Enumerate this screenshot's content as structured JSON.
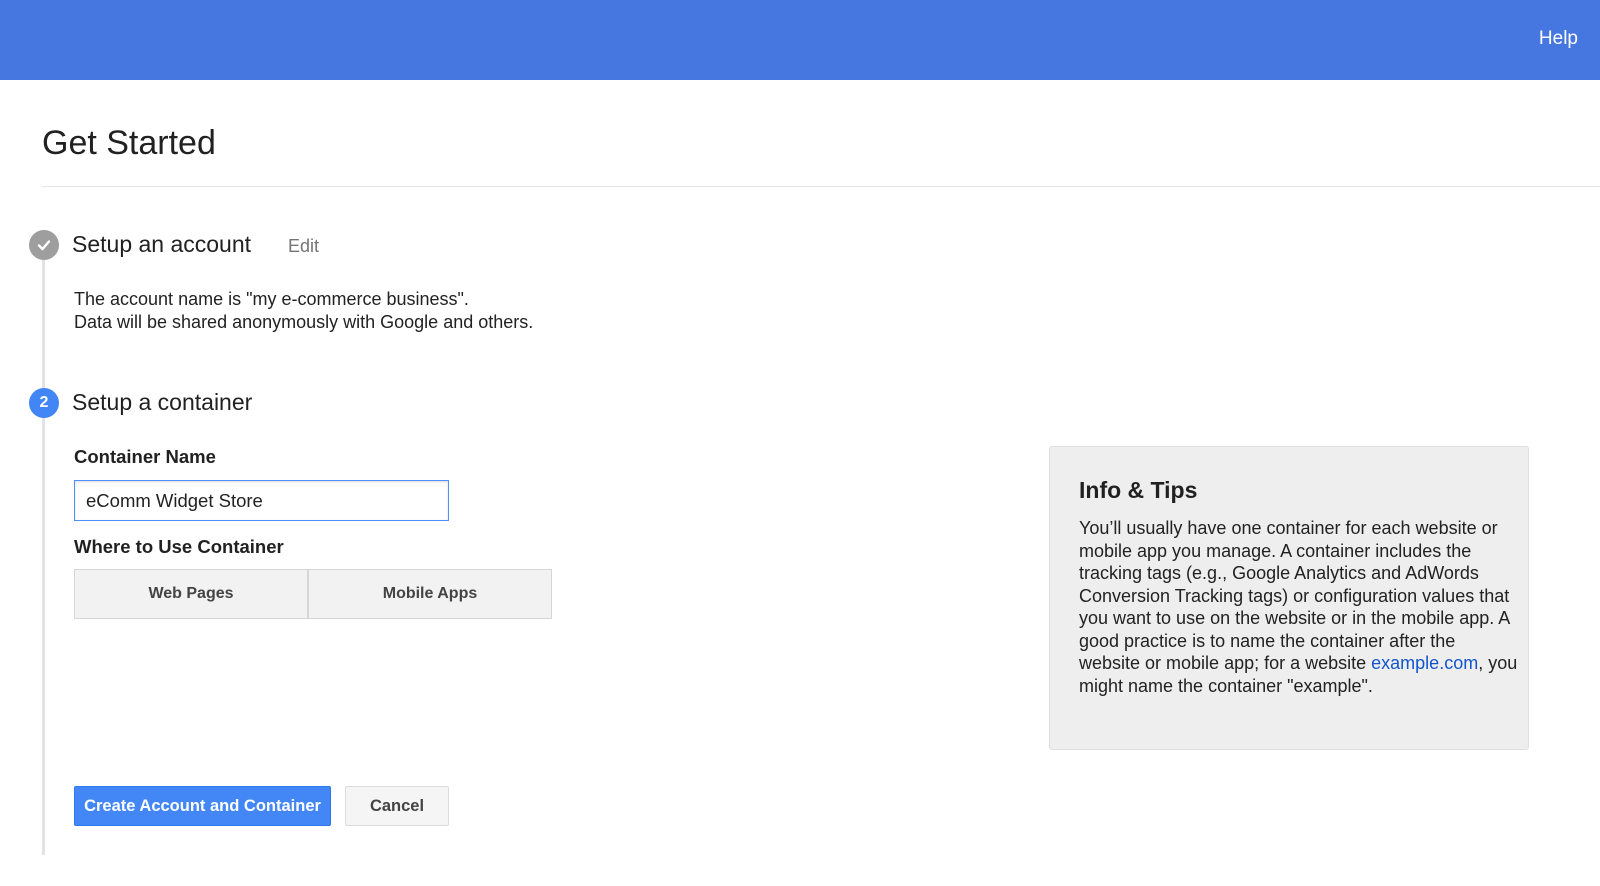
{
  "header": {
    "help_label": "Help",
    "bar_color": "#4677e0"
  },
  "page": {
    "title": "Get Started"
  },
  "steps": [
    {
      "status": "complete",
      "badge_icon": "check-icon",
      "title": "Setup an account",
      "edit_label": "Edit",
      "summary_lines": [
        "The account name is \"my e-commerce business\".",
        "Data will be shared anonymously with Google and others."
      ]
    },
    {
      "status": "active",
      "number": "2",
      "title": "Setup a container"
    }
  ],
  "container_form": {
    "name_label": "Container Name",
    "name_value": "eComm Widget Store",
    "where_label": "Where to Use Container",
    "options": [
      "Web Pages",
      "Mobile Apps"
    ]
  },
  "info": {
    "title": "Info & Tips",
    "body_before_link": "You’ll usually have one container for each website or mobile app you manage. A container includes the tracking tags (e.g., Google Analytics and AdWords Conversion Tracking tags) or configuration values that you want to use on the website or in the mobile app. A good practice is to name the container after the website or mobile app; for a website ",
    "link_text": "example.com",
    "body_after_link": ", you might name the container \"example\"."
  },
  "actions": {
    "primary_label": "Create Account and Container",
    "cancel_label": "Cancel",
    "primary_color": "#4387f6"
  }
}
